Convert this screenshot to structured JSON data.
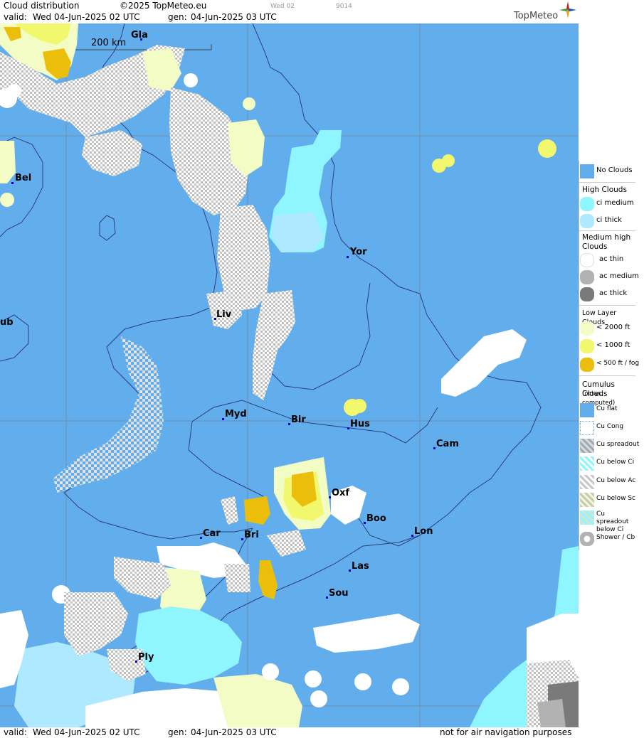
{
  "header": {
    "title": "Cloud distribution",
    "copyright": "©2025 TopMeteo.eu",
    "valid_label": "valid:",
    "valid_value": "Wed  04-Jun-2025  02 UTC",
    "gen_label": "gen:",
    "gen_value": "04-Jun-2025 03 UTC",
    "faint_day": "Wed 02",
    "faint_code": "9014",
    "brand": "TopMeteo"
  },
  "map": {
    "scale_label": "200 km",
    "cities": [
      {
        "name": "Gla"
      },
      {
        "name": "Bel"
      },
      {
        "name": "Yor"
      },
      {
        "name": "Liv"
      },
      {
        "name": "ub"
      },
      {
        "name": "Myd"
      },
      {
        "name": "Bir"
      },
      {
        "name": "Hus"
      },
      {
        "name": "Cam"
      },
      {
        "name": "Oxf"
      },
      {
        "name": "Boo"
      },
      {
        "name": "Lon"
      },
      {
        "name": "Car"
      },
      {
        "name": "Bri"
      },
      {
        "name": "Las"
      },
      {
        "name": "Sou"
      },
      {
        "name": "Ply"
      }
    ]
  },
  "legend": {
    "no_clouds": "No Clouds",
    "high_head": "High Clouds",
    "ci_medium": "ci medium",
    "ci_thick": "ci thick",
    "medium_head": "Medium high Clouds",
    "ac_thin": "ac thin",
    "ac_medium": "ac medium",
    "ac_thick": "ac thick",
    "low_head": "Low Layer Clouds",
    "lt2000": "< 2000 ft",
    "lt1000": "< 1000 ft",
    "lt500": "< 500 ft / fog",
    "cu_head": "Cumulus Clouds",
    "cu_sub": "(octas computed)",
    "cu_flat": "Cu flat",
    "cu_cong": "Cu Cong",
    "cu_spread": "Cu spreadout",
    "cu_below_ci": "Cu below Ci",
    "cu_below_ac": "Cu below Ac",
    "cu_below_sc": "Cu below Sc",
    "cu_spread_ci": "Cu spreadout below Ci",
    "shower": "Shower / Cb"
  },
  "footer": {
    "valid_label": "valid:",
    "valid_value": "Wed  04-Jun-2025  02 UTC",
    "gen_label": "gen:",
    "gen_value": "04-Jun-2025 03 UTC",
    "disclaimer": "not for air navigation purposes"
  },
  "colors": {
    "sea_no_cloud": "#62aeed",
    "ci_medium": "#8ff6ff",
    "ci_thick": "#aee9ff",
    "ac_thin": "#ffffff",
    "ac_medium": "#b2b2b2",
    "ac_thick": "#7a7a7a",
    "low_2000": "#f4fcc6",
    "low_1000": "#f2f86e",
    "low_500": "#eabe0a",
    "city_marker": "#0000cc"
  }
}
